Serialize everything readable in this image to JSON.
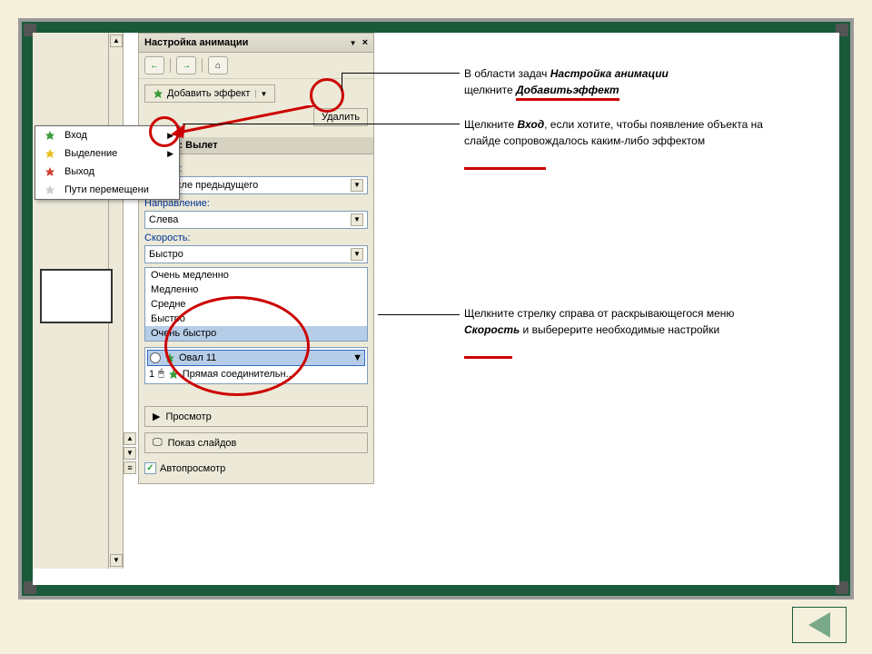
{
  "taskpane": {
    "title": "Настройка анимации",
    "add_effect": "Добавить эффект",
    "remove": "Удалить",
    "modify_header": "енение: Вылет",
    "start_label": "Начало:",
    "start_value": "После предыдущего",
    "direction_label": "Направление:",
    "direction_value": "Слева",
    "speed_label": "Скорость:",
    "speed_value": "Быстро",
    "speed_options": [
      "Очень медленно",
      "Медленно",
      "Средне",
      "Быстро",
      "Очень быстро"
    ],
    "anim_items": [
      {
        "label": "Овал 11"
      },
      {
        "label": "Прямая соединительн..."
      }
    ],
    "anim_index": "1",
    "preview": "Просмотр",
    "slideshow": "Показ слайдов",
    "autopreview": "Автопросмотр"
  },
  "context_menu": {
    "items": [
      {
        "label": "Вход",
        "star": "green",
        "arrow": true
      },
      {
        "label": "Выделение",
        "star": "yellow",
        "arrow": true
      },
      {
        "label": "Выход",
        "star": "red",
        "arrow": false
      },
      {
        "label": "Пути перемещени",
        "star": "gray",
        "arrow": false
      }
    ]
  },
  "annotations": {
    "a1_pre": "В области задач ",
    "a1_bold1": "Настройка анимации",
    "a1_mid": "щелкните ",
    "a1_bold2": "Добавитьэффект",
    "a2_pre": "Щелкните ",
    "a2_bold": "Вход",
    "a2_post": ", если хотите, чтобы появление объекта на слайде сопровождалось каким-либо эффектом",
    "a3_pre": "Щелкните стрелку справа от раскрывающегося меню ",
    "a3_bold": "Скорость",
    "a3_post": " и выберерите необходимые настройки"
  }
}
